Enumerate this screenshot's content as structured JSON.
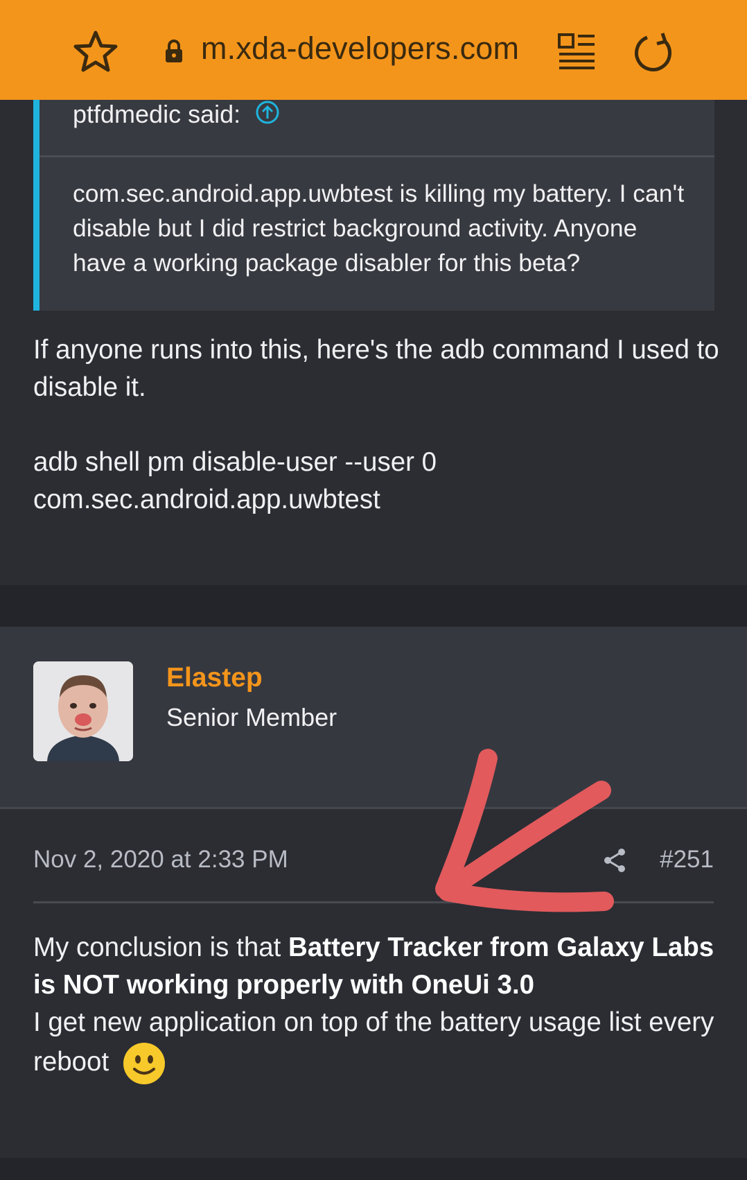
{
  "browser": {
    "url": "m.xda-developers.com"
  },
  "quote": {
    "author_line": "ptfdmedic said:",
    "text": "com.sec.android.app.uwbtest is killing my battery. I can't disable but I did restrict background activity. Anyone have a working package disabler for this beta?"
  },
  "post1": {
    "paragraph1": "If anyone runs into this, here's the adb command I used to disable it.",
    "paragraph2": "adb shell pm disable-user --user 0 com.sec.android.app.uwbtest"
  },
  "post2": {
    "username": "Elastep",
    "user_title": "Senior Member",
    "date": "Nov 2, 2020 at 2:33 PM",
    "post_number": "#251",
    "body_intro": "My conclusion is that ",
    "body_bold": "Battery Tracker from Galaxy Labs is NOT working properly with OneUi 3.0",
    "body_rest": "I get new application on top of the battery usage list every reboot"
  },
  "colors": {
    "accent_orange": "#f4951b",
    "quote_bar": "#1fb4dd",
    "annotation_arrow": "#e25a5c"
  },
  "icons": {
    "bookmark": "star-icon",
    "secure": "lock-icon",
    "reader_mode": "reader-mode-icon",
    "reload": "reload-icon",
    "jump_to_quote": "arrow-up-circle-icon",
    "share": "share-icon",
    "emoji": "smiley-emoji-icon"
  }
}
